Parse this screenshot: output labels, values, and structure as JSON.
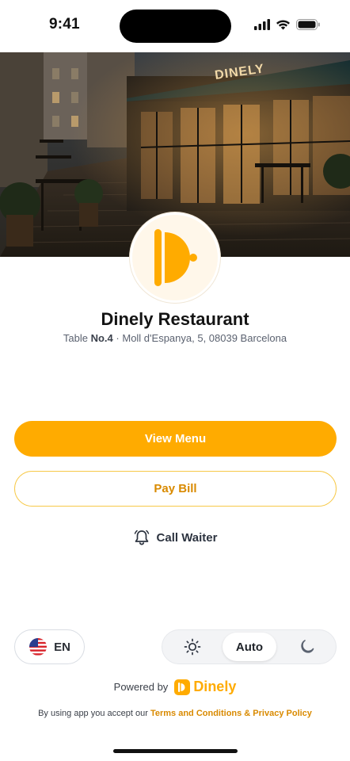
{
  "status_bar": {
    "time": "9:41"
  },
  "hero": {
    "sign_text": "DINELY"
  },
  "restaurant": {
    "name": "Dinely Restaurant",
    "table_prefix": "Table",
    "table_number": "No.4",
    "separator": "·",
    "address": "Moll d'Espanya, 5, 08039 Barcelona"
  },
  "actions": {
    "view_menu": "View Menu",
    "pay_bill": "Pay Bill",
    "call_waiter": "Call Waiter"
  },
  "language": {
    "code": "EN",
    "flag": "us-flag-icon"
  },
  "theme": {
    "options": [
      "light",
      "Auto",
      "dark"
    ],
    "selected": "Auto",
    "auto_label": "Auto"
  },
  "footer": {
    "powered_by": "Powered by",
    "brand": "Dinely",
    "legal_prefix": "By using app you accept our",
    "legal_link": "Terms and Conditions & Privacy Policy"
  },
  "colors": {
    "accent": "#ffab00",
    "accent_text": "#d98a00",
    "badge_bg": "#fff7ea"
  }
}
